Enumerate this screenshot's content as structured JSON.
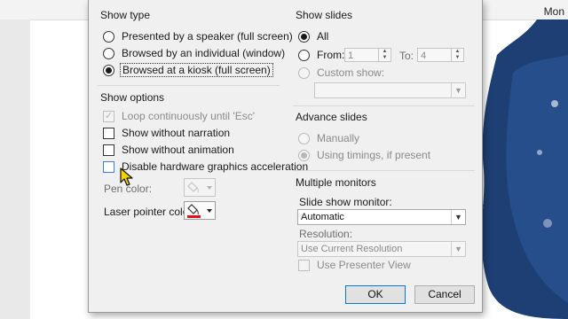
{
  "background": {
    "ribbon_text": "Mon",
    "splash_color": "#1d3f73"
  },
  "dialog": {
    "show_type": {
      "title": "Show type",
      "options": [
        {
          "label": "Presented by a speaker (full screen)",
          "selected": false
        },
        {
          "label": "Browsed by an individual (window)",
          "selected": false
        },
        {
          "label": "Browsed at a kiosk (full screen)",
          "selected": true
        }
      ]
    },
    "show_options": {
      "title": "Show options",
      "loop_label": "Loop continuously until 'Esc'",
      "no_narration_label": "Show without narration",
      "no_animation_label": "Show without animation",
      "disable_hw_label": "Disable hardware graphics acceleration",
      "pen_color_label": "Pen color:",
      "laser_color_label": "Laser pointer color:",
      "laser_color": "#e0131c",
      "pen_color": "#bdbdbd"
    },
    "show_slides": {
      "title": "Show slides",
      "all_label": "All",
      "from_label": "From:",
      "from_value": "1",
      "to_label": "To:",
      "to_value": "4",
      "custom_label": "Custom show:",
      "custom_value": ""
    },
    "advance_slides": {
      "title": "Advance slides",
      "manual_label": "Manually",
      "timings_label": "Using timings, if present"
    },
    "monitors": {
      "title": "Multiple monitors",
      "monitor_label": "Slide show monitor:",
      "monitor_value": "Automatic",
      "resolution_label": "Resolution:",
      "resolution_value": "Use Current Resolution",
      "presenter_label": "Use Presenter View"
    },
    "ok_label": "OK",
    "cancel_label": "Cancel"
  }
}
